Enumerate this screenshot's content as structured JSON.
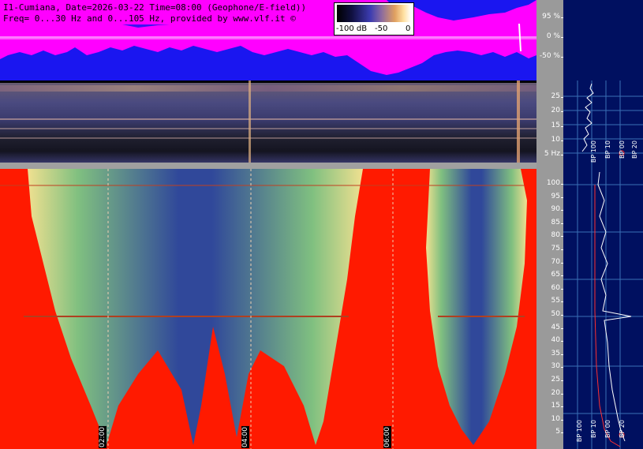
{
  "header": {
    "line1": "I1-Cumiana, Date=2026-03-22 Time=08:00 (Geophone/E-field))",
    "line2": "Freq= 0...30 Hz and 0...105 Hz, provided by www.vlf.it ©"
  },
  "colorbar": {
    "labels": [
      "-100 dB",
      "-50",
      "0"
    ]
  },
  "amplitude_axis": {
    "ticks": [
      "95 %",
      "0 %",
      "-50 %"
    ]
  },
  "low_freq_axis": {
    "ticks": [
      "25",
      "20",
      "15",
      "10",
      "5 Hz"
    ]
  },
  "high_freq_axis": {
    "ticks": [
      "100",
      "95",
      "90",
      "85",
      "80",
      "75",
      "70",
      "65",
      "60",
      "55",
      "50",
      "45",
      "40",
      "35",
      "30",
      "25",
      "20",
      "15",
      "10",
      "5"
    ]
  },
  "side_labels": {
    "bp_top": [
      "BP 100",
      "BP 10",
      "BP 00",
      "BP 20"
    ],
    "bp_bottom": [
      "BP 100",
      "BP 10",
      "BP 00",
      "BP 20"
    ]
  },
  "time_markers": [
    "02:00",
    "04:00",
    "06:00"
  ],
  "colors": {
    "magenta": "#ff00ff",
    "blue": "#1a16f0",
    "red": "#ff1a00",
    "navy": "#001060",
    "axis_grey": "#9a9a9a"
  }
}
